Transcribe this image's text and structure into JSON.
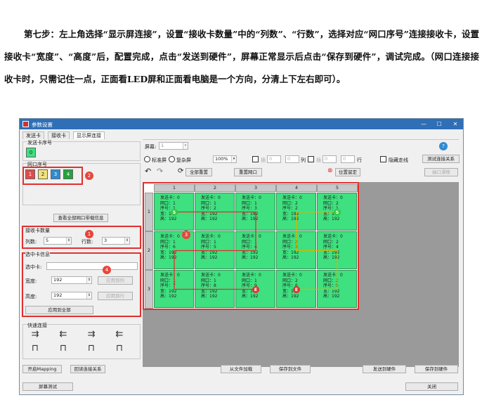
{
  "paragraph": "第七步：左上角选择“显示屏连接”，设置“接收卡数量”中的“列数”、“行数”，选择对应“网口序号”连接接收卡，设置接收卡“宽度”、“高度”后，配置完成，点击“发送到硬件”，屏幕正常显示后点击“保存到硬件”，调试完成。（网口连接接收卡时，只需记住一点，正面看LED屏和正面看电脑是一个方向，分清上下左右即可）。",
  "window": {
    "title": "参数设置",
    "min": "—",
    "max": "☐",
    "close": "✕"
  },
  "tabs": [
    "发送卡",
    "接收卡",
    "显示屏连接"
  ],
  "left": {
    "sender_group": "发送卡序号",
    "sender_selected": "0",
    "port_group": "网口序号",
    "ports": [
      {
        "label": "1",
        "color": "#e24a4a"
      },
      {
        "label": "2",
        "color": "#f2e27a"
      },
      {
        "label": "3",
        "color": "#2f8bd0"
      },
      {
        "label": "4",
        "color": "#22a43a"
      }
    ],
    "view_btn": "查看全部网口带载信息",
    "count_group": "接收卡数量",
    "cols_label": "列数:",
    "cols_value": "5",
    "rows_label": "行数:",
    "rows_value": "3",
    "sel_group": "选中卡信息",
    "sel_label": "选中卡:",
    "sel_value": "",
    "width_label": "宽度:",
    "width_value": "192",
    "height_label": "高度:",
    "height_value": "192",
    "apply_col": "应用到列",
    "apply_row": "应用到行",
    "apply_all": "应用到全部",
    "quick_group": "快速连接"
  },
  "badges": [
    "1",
    "2",
    "3",
    "4"
  ],
  "top": {
    "screen_label": "屏幕:",
    "screen_value": "1",
    "help": "?",
    "radio1": "标准屏",
    "radio2": "复杂屏",
    "zoom": "100%",
    "chk1": "插",
    "v1": "0",
    "v2": "0",
    "col_lbl": "列",
    "chk2": "插",
    "v3": "0",
    "v4": "0",
    "row_lbl": "行",
    "hide_lines": "隐藏走线",
    "test_btn": "测试连接关系",
    "undo": "↶",
    "redo": "↷",
    "reset_all": "全部重置",
    "reset_port": "重置网口",
    "reset_pos": "位置留定",
    "port_shift": "端口漂移"
  },
  "col_headers": [
    "1",
    "2",
    "3",
    "4",
    "5"
  ],
  "row_headers": [
    "1",
    "2",
    "3"
  ],
  "cells": [
    [
      {
        "l1": "发送卡：0",
        "l2": "网口：1",
        "l3": "序号：1",
        "l4": "宽：192",
        "l5": "高：192"
      },
      {
        "l1": "发送卡：0",
        "l2": "网口：1",
        "l3": "序号：2",
        "l4": "宽：192",
        "l5": "高：192"
      },
      {
        "l1": "发送卡：0",
        "l2": "网口：1",
        "l3": "序号：3",
        "l4": "宽：192",
        "l5": "高：192"
      },
      {
        "l1": "发送卡：0",
        "l2": "网口：2",
        "l3": "序号：2",
        "l4": "宽：192",
        "l5": "高：192"
      },
      {
        "l1": "发送卡：0",
        "l2": "网口：2",
        "l3": "序号：1",
        "l4": "宽：192",
        "l5": "高：192"
      }
    ],
    [
      {
        "l1": "发送卡：0",
        "l2": "网口：1",
        "l3": "序号：6",
        "l4": "宽：192",
        "l5": "高：192"
      },
      {
        "l1": "发送卡：0",
        "l2": "网口：1",
        "l3": "序号：5",
        "l4": "宽：192",
        "l5": "高：192"
      },
      {
        "l1": "发送卡：0",
        "l2": "网口：1",
        "l3": "序号：4",
        "l4": "宽：192",
        "l5": "高：192"
      },
      {
        "l1": "发送卡：0",
        "l2": "网口：2",
        "l3": "序号：3",
        "l4": "宽：192",
        "l5": "高：192"
      },
      {
        "l1": "发送卡：0",
        "l2": "网口：2",
        "l3": "序号：4",
        "l4": "宽：192",
        "l5": "高：192"
      }
    ],
    [
      {
        "l1": "发送卡：0",
        "l2": "网口：1",
        "l3": "序号：7",
        "l4": "宽：192",
        "l5": "高：192"
      },
      {
        "l1": "发送卡：0",
        "l2": "网口：1",
        "l3": "序号：8",
        "l4": "宽：192",
        "l5": "高：192"
      },
      {
        "l1": "发送卡：0",
        "l2": "网口：1",
        "l3": "序号：9",
        "l4": "宽：192",
        "l5": "高：192"
      },
      {
        "l1": "发送卡：0",
        "l2": "网口：2",
        "l3": "序号：6",
        "l4": "宽：192",
        "l5": "高：192"
      },
      {
        "l1": "发送卡：0",
        "l2": "网口：2",
        "l3": "序号：5",
        "l4": "宽：192",
        "l5": "高：192"
      }
    ]
  ],
  "markers": {
    "start": "S",
    "end": "E"
  },
  "bottom": {
    "mapping": "开启Mapping",
    "read": "回读连接关系",
    "load": "从文件加载",
    "save_file": "保存到文件",
    "send": "发送到硬件",
    "save_hw": "保存到硬件",
    "test": "屏幕测试",
    "close": "关闭"
  }
}
